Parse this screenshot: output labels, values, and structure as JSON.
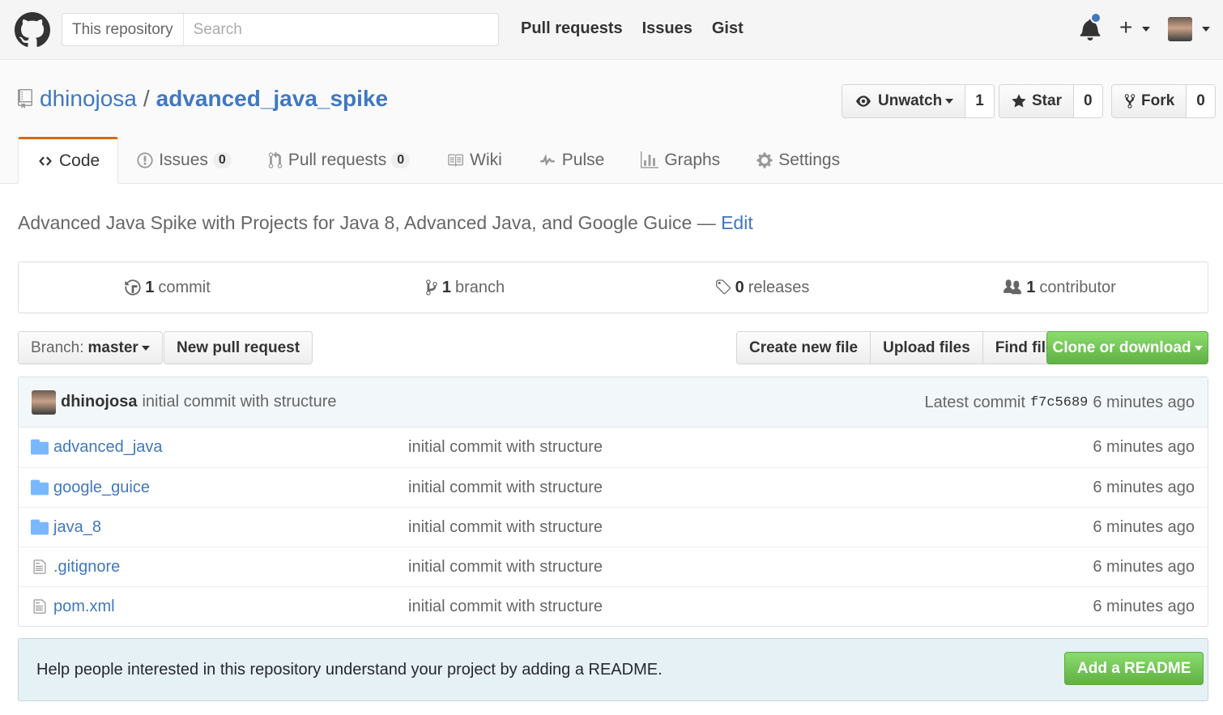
{
  "header": {
    "search_scope": "This repository",
    "search_placeholder": "Search",
    "nav": [
      "Pull requests",
      "Issues",
      "Gist"
    ]
  },
  "repo": {
    "owner": "dhinojosa",
    "separator": "/",
    "name": "advanced_java_spike",
    "watch_label": "Unwatch",
    "watch_count": "1",
    "star_label": "Star",
    "star_count": "0",
    "fork_label": "Fork",
    "fork_count": "0"
  },
  "tabs": [
    {
      "label": "Code"
    },
    {
      "label": "Issues",
      "count": "0"
    },
    {
      "label": "Pull requests",
      "count": "0"
    },
    {
      "label": "Wiki"
    },
    {
      "label": "Pulse"
    },
    {
      "label": "Graphs"
    },
    {
      "label": "Settings"
    }
  ],
  "description": {
    "text": "Advanced Java Spike with Projects for Java 8, Advanced Java, and Google Guice",
    "dash": "—",
    "edit": "Edit"
  },
  "summary": {
    "commits_num": "1",
    "commits_label": "commit",
    "branches_num": "1",
    "branches_label": "branch",
    "releases_num": "0",
    "releases_label": "releases",
    "contributors_num": "1",
    "contributors_label": "contributor"
  },
  "filenav": {
    "branch_prefix": "Branch:",
    "branch_name": "master",
    "new_pr": "New pull request",
    "create_file": "Create new file",
    "upload_files": "Upload files",
    "find_file": "Find file",
    "clone": "Clone or download"
  },
  "commit": {
    "author": "dhinojosa",
    "message": "initial commit with structure",
    "latest_label": "Latest commit",
    "sha": "f7c5689",
    "age": "6 minutes ago"
  },
  "files": [
    {
      "name": "advanced_java",
      "type": "dir",
      "message": "initial commit with structure",
      "age": "6 minutes ago"
    },
    {
      "name": "google_guice",
      "type": "dir",
      "message": "initial commit with structure",
      "age": "6 minutes ago"
    },
    {
      "name": "java_8",
      "type": "dir",
      "message": "initial commit with structure",
      "age": "6 minutes ago"
    },
    {
      "name": ".gitignore",
      "type": "file",
      "message": "initial commit with structure",
      "age": "6 minutes ago"
    },
    {
      "name": "pom.xml",
      "type": "file",
      "message": "initial commit with structure",
      "age": "6 minutes ago"
    }
  ],
  "readme": {
    "text": "Help people interested in this repository understand your project by adding a README.",
    "button": "Add a README"
  },
  "colors": {
    "accent": "#4078c0",
    "tab_highlight": "#d26911",
    "green": "#60b044"
  }
}
